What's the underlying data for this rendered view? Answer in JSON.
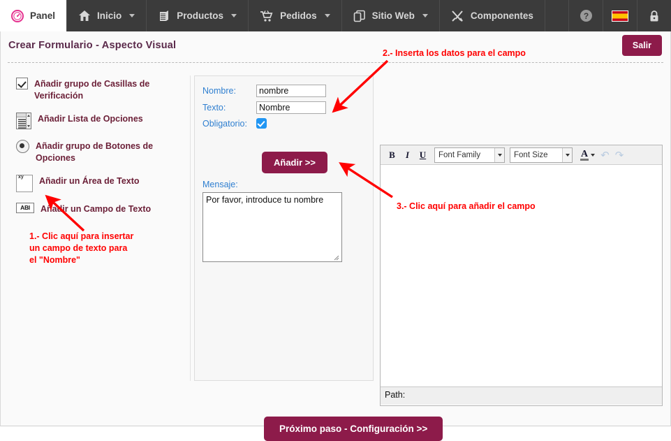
{
  "topnav": {
    "items": [
      {
        "label": "Panel",
        "icon": "gauge-icon",
        "active": true,
        "caret": false
      },
      {
        "label": "Inicio",
        "icon": "home-icon",
        "active": false,
        "caret": true
      },
      {
        "label": "Productos",
        "icon": "boxes-icon",
        "active": false,
        "caret": true
      },
      {
        "label": "Pedidos",
        "icon": "cart-icon",
        "active": false,
        "caret": true
      },
      {
        "label": "Sitio Web",
        "icon": "pages-icon",
        "active": false,
        "caret": true
      },
      {
        "label": "Componentes",
        "icon": "tools-icon",
        "active": false,
        "caret": false
      }
    ],
    "right_icons": [
      "help-icon",
      "spanish-flag-icon",
      "lock-icon"
    ]
  },
  "header": {
    "title": "Crear Formulario - Aspecto Visual",
    "exit_label": "Salir"
  },
  "sidebar": {
    "items": [
      {
        "label": "Añadir grupo de Casillas de Verificación",
        "icon": "checkbox-icon"
      },
      {
        "label": "Añadir Lista de Opciones",
        "icon": "select-list-icon"
      },
      {
        "label": "Añadir grupo de Botones de Opciones",
        "icon": "radio-button-icon"
      },
      {
        "label": "Añadir un Área de Texto",
        "icon": "textarea-icon"
      },
      {
        "label": "Añadir un Campo de Texto",
        "icon": "textfield-icon"
      }
    ]
  },
  "form": {
    "nombre_label": "Nombre:",
    "nombre_value": "nombre",
    "texto_label": "Texto:",
    "texto_value": "Nombre",
    "obligatorio_label": "Obligatorio:",
    "obligatorio_checked": true,
    "add_label": "Añadir >>",
    "mensaje_label": "Mensaje:",
    "mensaje_value": "Por favor, introduce tu nombre"
  },
  "editor": {
    "bold": "B",
    "italic": "I",
    "underline": "U",
    "font_family": "Font Family",
    "font_size": "Font Size",
    "text_color_glyph": "A",
    "undo_glyph": "↶",
    "redo_glyph": "↷",
    "content": "",
    "status_label": "Path:"
  },
  "footer": {
    "next_label": "Próximo paso - Configuración >>"
  },
  "annotations": [
    {
      "id": "1",
      "text": "1.- Clic aquí para insertar\nun campo de texto para\nel \"Nombre\""
    },
    {
      "id": "2",
      "text": "2.- Inserta los datos para el campo"
    },
    {
      "id": "3",
      "text": "3.- Clic aquí para añadir el campo"
    }
  ],
  "colors": {
    "accent": "#8d1b4a",
    "nav_bg": "#3b3b3b",
    "label_blue": "#2f7fd0",
    "annotation_red": "#ff0000",
    "sidebar_label": "#6b1f37"
  }
}
